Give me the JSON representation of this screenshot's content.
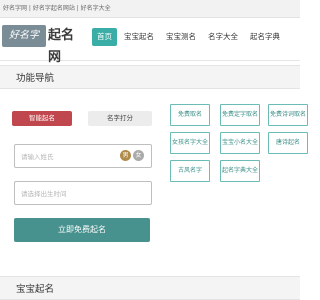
{
  "topbar": {
    "text": "好名字网 | 好名字起名网站 | 好名字大全"
  },
  "logo": {
    "mark": "好名字",
    "text": "起名网"
  },
  "nav": [
    "首页",
    "宝宝起名",
    "宝宝测名",
    "名字大全",
    "起名字典"
  ],
  "section1": {
    "title": "功能导航"
  },
  "tabs": {
    "smart": "智能起名",
    "score": "名字打分"
  },
  "form": {
    "surname_placeholder": "请输入姓氏",
    "male": "男",
    "female": "女",
    "birth_placeholder": "请选择出生时间",
    "submit": "立即免费起名"
  },
  "links": [
    "免费取名",
    "免费定字取名",
    "免费诗词取名",
    "女孩名字大全",
    "宝宝小名大全",
    "唐诗起名",
    "古风名字",
    "起名字典大全"
  ],
  "section2": {
    "title": "宝宝起名"
  }
}
